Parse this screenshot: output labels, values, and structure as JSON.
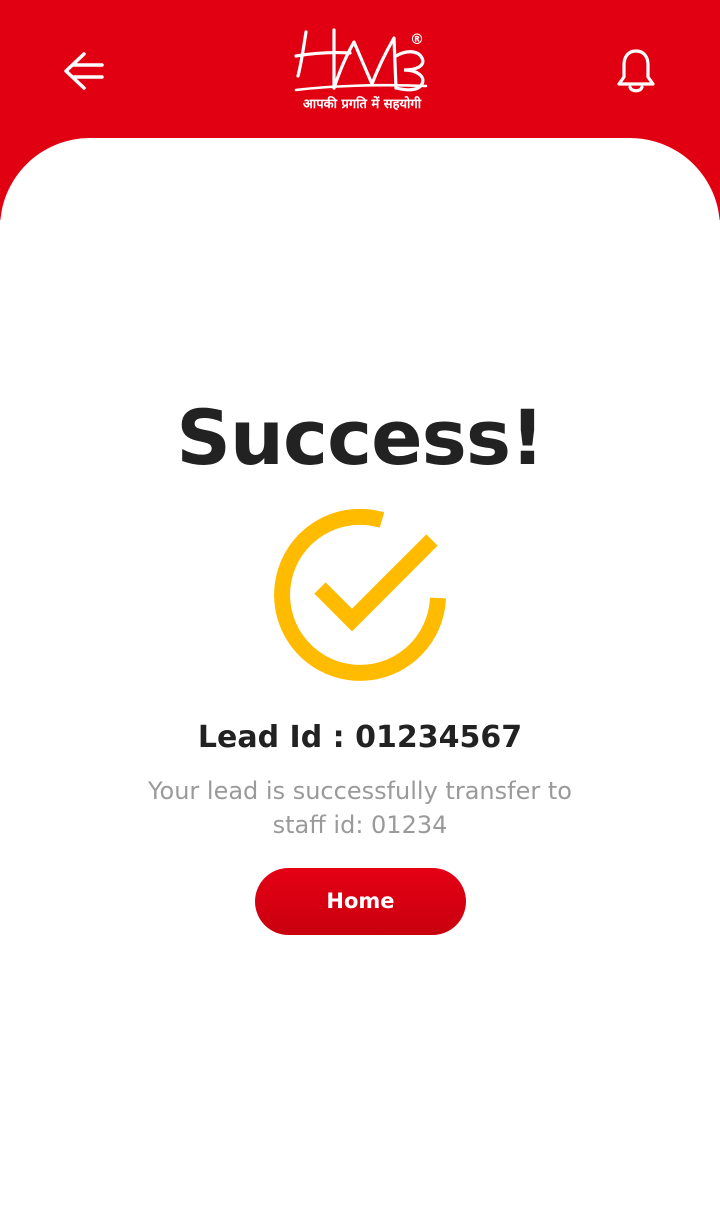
{
  "header": {
    "logo_text": "HMB",
    "logo_registered": "®",
    "logo_tagline": "आपकी प्रगति में सहयोगी",
    "back_icon": "arrow-left-icon",
    "notification_icon": "bell-icon"
  },
  "main": {
    "title": "Success!",
    "status_icon": "check-circle-icon",
    "lead_line": "Lead Id : 01234567",
    "message": "Your lead is successfully transfer to staff id: 01234",
    "home_label": "Home"
  },
  "colors": {
    "brand_red": "#e10012",
    "accent_yellow": "#ffbb00",
    "title_text": "#222222",
    "muted_text": "#9a9a9a",
    "background": "#ffffff"
  }
}
